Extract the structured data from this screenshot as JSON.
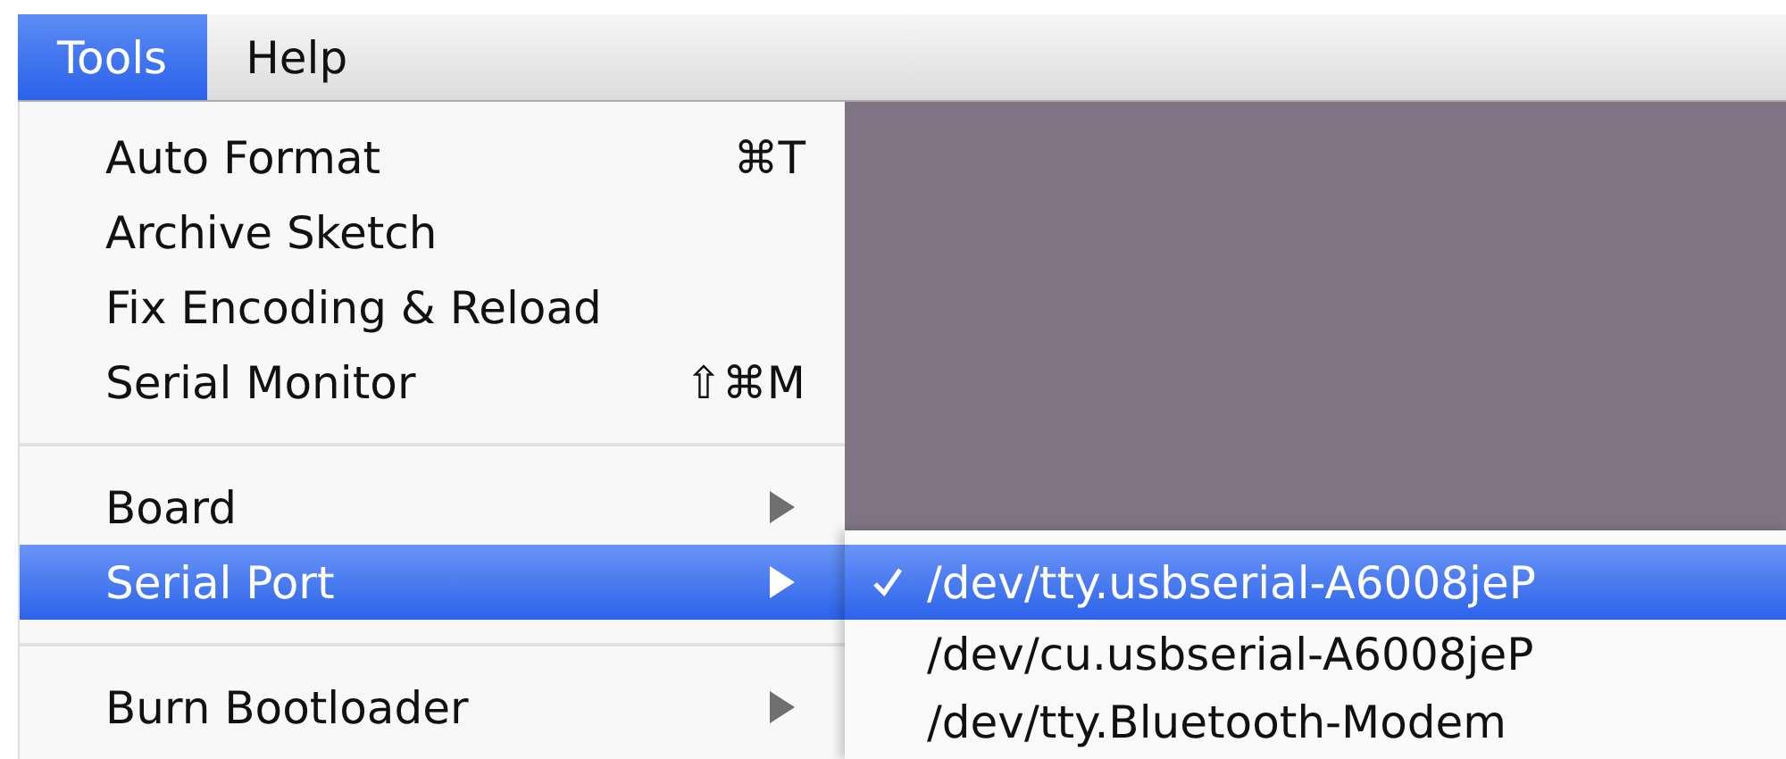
{
  "menubar": [
    {
      "label": "Tools",
      "selected": true
    },
    {
      "label": "Help",
      "selected": false
    }
  ],
  "tools_menu": {
    "items": [
      {
        "kind": "item",
        "label": "Auto Format",
        "shortcut": "⌘T",
        "submenu": false,
        "selected": false
      },
      {
        "kind": "item",
        "label": "Archive Sketch",
        "submenu": false,
        "selected": false
      },
      {
        "kind": "item",
        "label": "Fix Encoding & Reload",
        "submenu": false,
        "selected": false
      },
      {
        "kind": "item",
        "label": "Serial Monitor",
        "shortcut": "⇧⌘M",
        "submenu": false,
        "selected": false
      },
      {
        "kind": "separator"
      },
      {
        "kind": "item",
        "label": "Board",
        "submenu": true,
        "selected": false
      },
      {
        "kind": "item",
        "label": "Serial Port",
        "submenu": true,
        "selected": true
      },
      {
        "kind": "separator"
      },
      {
        "kind": "item",
        "label": "Burn Bootloader",
        "submenu": true,
        "selected": false
      }
    ]
  },
  "serial_port_menu": {
    "items": [
      {
        "label": "/dev/tty.usbserial-A6008jeP",
        "checked": true,
        "selected": true
      },
      {
        "label": "/dev/cu.usbserial-A6008jeP",
        "checked": false,
        "selected": false
      },
      {
        "label": "/dev/tty.Bluetooth-Modem",
        "checked": false,
        "selected": false
      }
    ]
  }
}
